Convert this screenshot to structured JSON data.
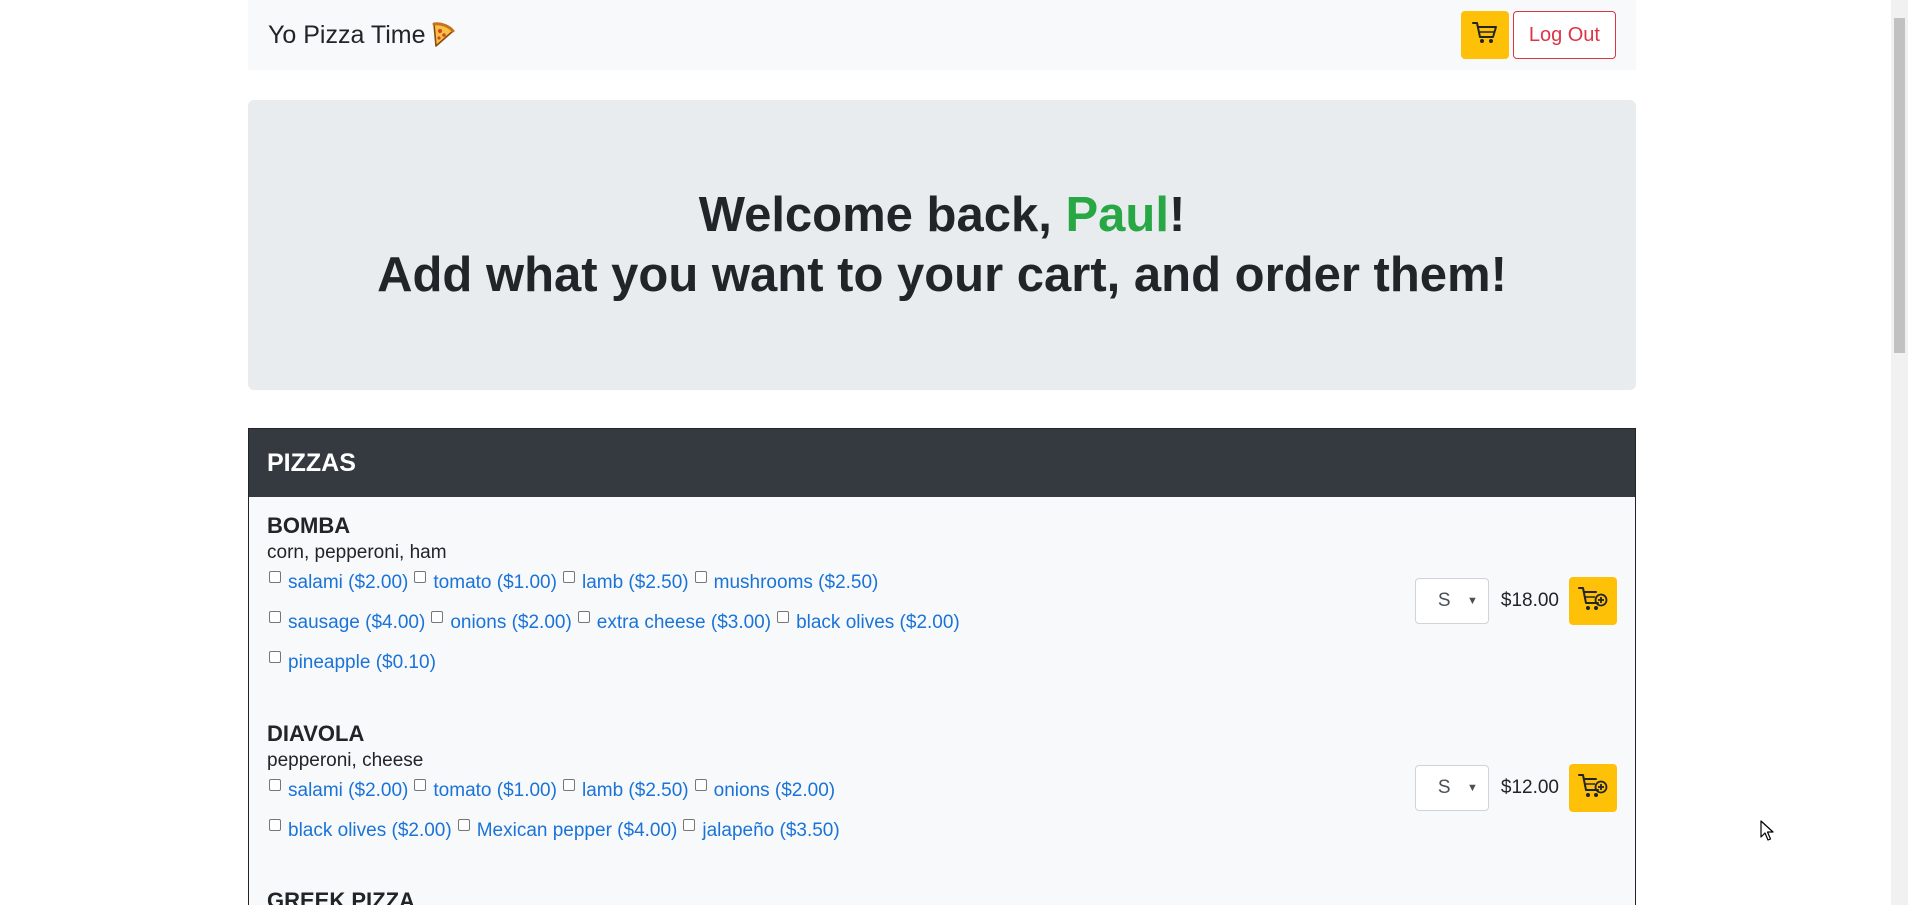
{
  "navbar": {
    "brand": "Yo Pizza Time",
    "brand_icon": "pizza-slice-icon",
    "cart_icon": "cart-icon",
    "logout_label": "Log Out"
  },
  "jumbotron": {
    "greeting_prefix": "Welcome back, ",
    "user_name": "Paul",
    "greeting_suffix": "!",
    "subline": "Add what you want to your cart, and order them!"
  },
  "menu": {
    "header": "PIZZAS",
    "pizzas": [
      {
        "name": "BOMBA",
        "description": "corn, pepperoni, ham",
        "toppings": [
          "salami ($2.00)",
          "tomato ($1.00)",
          "lamb ($2.50)",
          "mushrooms ($2.50)",
          "sausage ($4.00)",
          "onions ($2.00)",
          "extra cheese ($3.00)",
          "black olives ($2.00)",
          "pineapple ($0.10)"
        ],
        "size": "S",
        "price": "$18.00"
      },
      {
        "name": "DIAVOLA",
        "description": "pepperoni, cheese",
        "toppings": [
          "salami ($2.00)",
          "tomato ($1.00)",
          "lamb ($2.50)",
          "onions ($2.00)",
          "black olives ($2.00)",
          "Mexican pepper ($4.00)",
          "jalapeño ($3.50)"
        ],
        "size": "S",
        "price": "$12.00"
      },
      {
        "name": "GREEK PIZZA"
      }
    ]
  },
  "colors": {
    "accent_yellow": "#ffc107",
    "danger_red": "#dc3545",
    "success_green": "#28a745",
    "link_blue": "#1a73d9",
    "header_dark": "#343a40"
  }
}
